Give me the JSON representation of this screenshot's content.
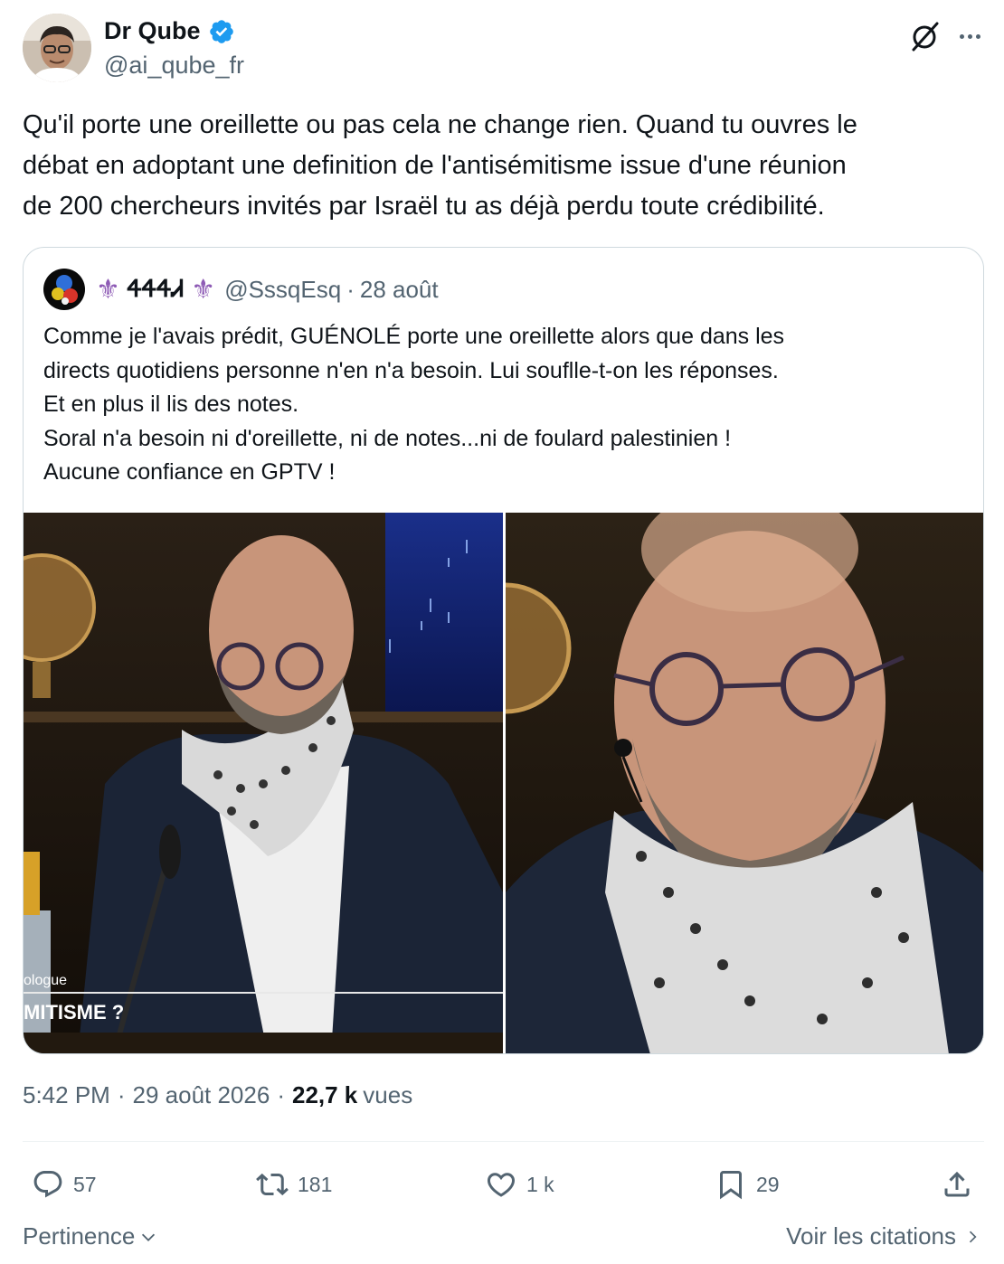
{
  "author": {
    "display_name": "Dr Qube",
    "handle": "@ai_qube_fr",
    "verified_icon": "verified-badge-icon"
  },
  "tweet": {
    "text_lines": [
      "Qu'il porte une oreillette ou pas cela ne change rien. Quand tu ouvres le",
      "débat en adoptant une definition de l'antisémitisme issue d'une réunion",
      "de 200 chercheurs invités par Israël tu as déjà perdu toute crédibilité."
    ]
  },
  "quote": {
    "display_name": "ᏎᏎᏎᏗ",
    "name_decoration": "⚜",
    "handle": "@SssqEsq",
    "separator": "·",
    "date": "28 août",
    "text_lines": [
      "Comme je l'avais prédit, GUÉNOLÉ porte une oreillette alors que dans les",
      "directs quotidiens personne n'en n'a besoin. Lui souflle-t-on les réponses.",
      "Et en plus il lis des notes.",
      "Soral n'a besoin ni d'oreillette, ni de notes...ni de foulard palestinien !",
      "Aucune confiance en GPTV !"
    ],
    "media": {
      "left_overlay_top": "ologue",
      "left_overlay_bottom": "MITISME ?"
    }
  },
  "meta": {
    "time": "5:42 PM",
    "separator": "·",
    "date": "29 août 2026",
    "separator2": "·",
    "views_count": "22,7 k",
    "views_label": "vues"
  },
  "actions": {
    "replies": "57",
    "reposts": "181",
    "likes": "1 k",
    "bookmarks": "29"
  },
  "footer": {
    "sort_label": "Pertinence",
    "quotes_link": "Voir les citations"
  },
  "colors": {
    "text": "#0f1419",
    "secondary": "#536471",
    "verified": "#1d9bf0",
    "border": "#cfd9de"
  }
}
